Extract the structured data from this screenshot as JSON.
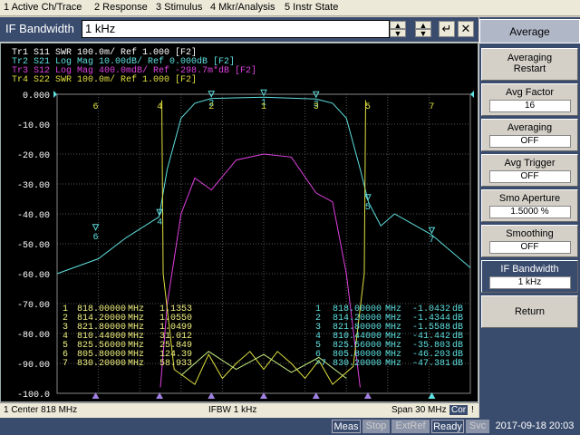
{
  "menu": [
    "1 Active Ch/Trace",
    "2 Response",
    "3 Stimulus",
    "4 Mkr/Analysis",
    "5 Instr State"
  ],
  "entry": {
    "label": "IF Bandwidth",
    "value": "1 kHz",
    "up": "▲",
    "down": "▼",
    "up2": "▲",
    "down2": "▼",
    "enter": "↵",
    "close": "✕"
  },
  "softkeys": {
    "title": "Average",
    "items": [
      {
        "label": "Averaging",
        "label2": "Restart",
        "value": ""
      },
      {
        "label": "Avg Factor",
        "label2": "",
        "value": "16"
      },
      {
        "label": "Averaging",
        "label2": "",
        "value": "OFF"
      },
      {
        "label": "Avg Trigger",
        "label2": "",
        "value": "OFF"
      },
      {
        "label": "Smo Aperture",
        "label2": "",
        "value": "1.5000  %"
      },
      {
        "label": "Smoothing",
        "label2": "",
        "value": "OFF"
      },
      {
        "label": "IF Bandwidth",
        "label2": "",
        "value": "1 kHz"
      },
      {
        "label": "Return",
        "label2": "",
        "value": ""
      }
    ]
  },
  "traces": [
    {
      "text": "Tr1  S11  SWR 100.0m/ Ref 1.000  [F2]",
      "color": "#ffffff"
    },
    {
      "text": "Tr2  S21  Log Mag 10.00dB/ Ref 0.000dB  [F2]",
      "color": "#5fe0e0"
    },
    {
      "text": "Tr3  S12  Log Mag 400.0mdB/ Ref -298.7m*dB  [F2]",
      "color": "#e040e0"
    },
    {
      "text": "Tr4  S22  SWR 100.0m/ Ref 1.000  [F2]",
      "color": "#e0e040"
    }
  ],
  "y_ticks": [
    "0.000",
    "-10.00",
    "-20.00",
    "-30.00",
    "-40.00",
    "-50.00",
    "-60.00",
    "-70.00",
    "-80.00",
    "-90.00",
    "-100.0"
  ],
  "marker_table_left": [
    [
      "1",
      "818.00000",
      "MHz",
      "1.1353"
    ],
    [
      "2",
      "814.20000",
      "MHz",
      "1.0550"
    ],
    [
      "3",
      "821.80000",
      "MHz",
      "1.0499"
    ],
    [
      "4",
      "810.44000",
      "MHz",
      "31.012"
    ],
    [
      "5",
      "825.56000",
      "MHz",
      "25.849"
    ],
    [
      "6",
      "805.80000",
      "MHz",
      "124.39"
    ],
    [
      "7",
      "830.20000",
      "MHz",
      "58.933"
    ]
  ],
  "marker_table_right": [
    [
      "1",
      "818.00000",
      "MHz",
      "-1.0432",
      "dB"
    ],
    [
      "2",
      "814.20000",
      "MHz",
      "-1.4344",
      "dB"
    ],
    [
      "3",
      "821.80000",
      "MHz",
      "-1.5588",
      "dB"
    ],
    [
      "4",
      "810.44000",
      "MHz",
      "-41.442",
      "dB"
    ],
    [
      "5",
      "825.56000",
      "MHz",
      "-35.803",
      "dB"
    ],
    [
      "6",
      "805.80000",
      "MHz",
      "-46.203",
      "dB"
    ],
    [
      ">7",
      "830.20000",
      "MHz",
      "-47.381",
      "dB"
    ]
  ],
  "status": {
    "center": "1  Center 818 MHz",
    "ifbw": "IFBW 1 kHz",
    "span": "Span 30 MHz",
    "cor": "Cor",
    "excl": "!"
  },
  "bottom": {
    "meas": "Meas",
    "stop": "Stop",
    "extref": "ExtRef",
    "ready": "Ready",
    "svc": "Svc",
    "datetime": "2017-09-18 20:03"
  },
  "colors": {
    "s21": "#5fe0e0",
    "s12": "#e040e0",
    "s22": "#e0e040",
    "s11": "#ffffff",
    "bg": "#3a4c6e"
  }
}
